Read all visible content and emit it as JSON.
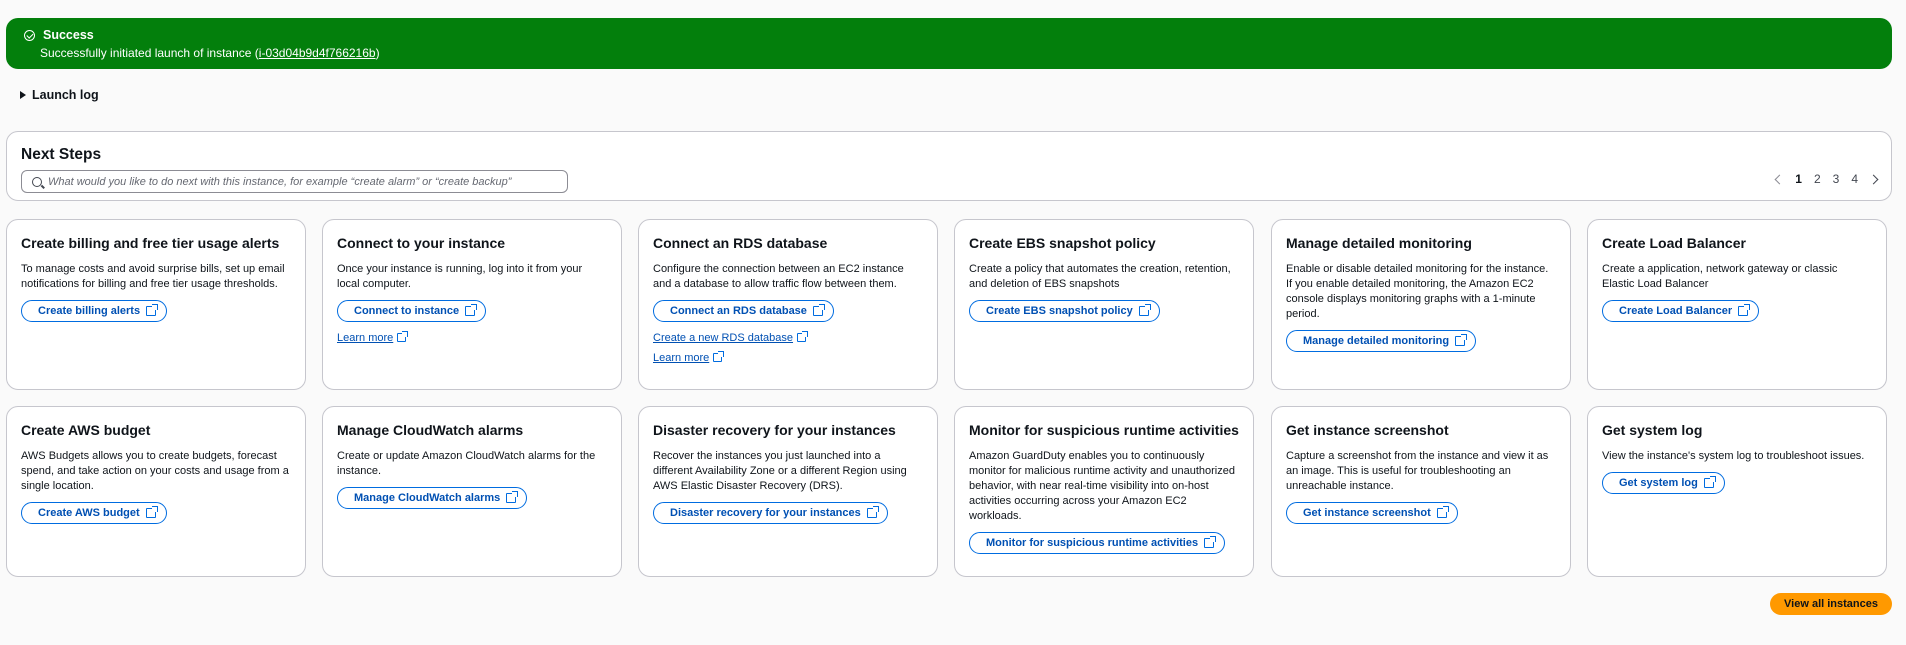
{
  "flash": {
    "title": "Success",
    "message_prefix": "Successfully initiated launch of instance (",
    "instance_id": "i-03d04b9d4f766216b",
    "message_suffix": ")"
  },
  "launch_log": {
    "label": "Launch log"
  },
  "next_steps": {
    "title": "Next Steps",
    "search_placeholder": "What would you like to do next with this instance, for example “create alarm” or “create backup”",
    "pages": [
      "1",
      "2",
      "3",
      "4"
    ],
    "current_page": "1"
  },
  "cards": [
    {
      "title": "Create billing and free tier usage alerts",
      "description": "To manage costs and avoid surprise bills, set up email notifications for billing and free tier usage thresholds.",
      "button": "Create billing alerts"
    },
    {
      "title": "Connect to your instance",
      "description": "Once your instance is running, log into it from your local computer.",
      "button": "Connect to instance",
      "links": [
        "Learn more"
      ]
    },
    {
      "title": "Connect an RDS database",
      "description": "Configure the connection between an EC2 instance and a database to allow traffic flow between them.",
      "button": "Connect an RDS database",
      "links": [
        "Create a new RDS database",
        "Learn more"
      ]
    },
    {
      "title": "Create EBS snapshot policy",
      "description": "Create a policy that automates the creation, retention, and deletion of EBS snapshots",
      "button": "Create EBS snapshot policy"
    },
    {
      "title": "Manage detailed monitoring",
      "description": "Enable or disable detailed monitoring for the instance. If you enable detailed monitoring, the Amazon EC2 console displays monitoring graphs with a 1-minute period.",
      "button": "Manage detailed monitoring"
    },
    {
      "title": "Create Load Balancer",
      "description": "Create a application, network gateway or classic Elastic Load Balancer",
      "button": "Create Load Balancer"
    },
    {
      "title": "Create AWS budget",
      "description": "AWS Budgets allows you to create budgets, forecast spend, and take action on your costs and usage from a single location.",
      "button": "Create AWS budget"
    },
    {
      "title": "Manage CloudWatch alarms",
      "description": "Create or update Amazon CloudWatch alarms for the instance.",
      "button": "Manage CloudWatch alarms"
    },
    {
      "title": "Disaster recovery for your instances",
      "description": "Recover the instances you just launched into a different Availability Zone or a different Region using AWS Elastic Disaster Recovery (DRS).",
      "button": "Disaster recovery for your instances"
    },
    {
      "title": "Monitor for suspicious runtime activities",
      "description": "Amazon GuardDuty enables you to continuously monitor for malicious runtime activity and unauthorized behavior, with near real-time visibility into on-host activities occurring across your Amazon EC2 workloads.",
      "button": "Monitor for suspicious runtime activities"
    },
    {
      "title": "Get instance screenshot",
      "description": "Capture a screenshot from the instance and view it as an image. This is useful for troubleshooting an unreachable instance.",
      "button": "Get instance screenshot"
    },
    {
      "title": "Get system log",
      "description": "View the instance's system log to troubleshoot issues.",
      "button": "Get system log"
    }
  ],
  "view_all": {
    "label": "View all instances"
  },
  "colors": {
    "success": "#037f0c",
    "link": "#0050b3",
    "primary": "#ff9900"
  }
}
